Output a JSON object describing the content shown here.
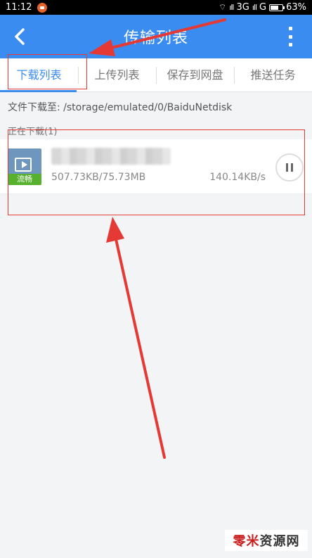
{
  "status_bar": {
    "time": "11:12",
    "network": "3G",
    "network2": "G",
    "battery": "63%"
  },
  "header": {
    "title": "传输列表",
    "back_icon": "back-arrow-icon",
    "more_icon": "more-vertical-icon",
    "background": "#3b8cf0"
  },
  "tabs": [
    {
      "label": "下载列表",
      "active": true
    },
    {
      "label": "上传列表",
      "active": false
    },
    {
      "label": "保存到网盘",
      "active": false
    },
    {
      "label": "推送任务",
      "active": false
    }
  ],
  "download_path": "文件下载至: /storage/emulated/0/BaiduNetdisk",
  "section_title": "正在下载(1)",
  "download_item": {
    "badge": "流畅",
    "size": "507.73KB/75.73MB",
    "speed": "140.14KB/s",
    "action_icon": "pause-icon"
  },
  "watermark": {
    "part1": "零米",
    "part2": "资源网"
  },
  "annotation_color": "#e53935"
}
